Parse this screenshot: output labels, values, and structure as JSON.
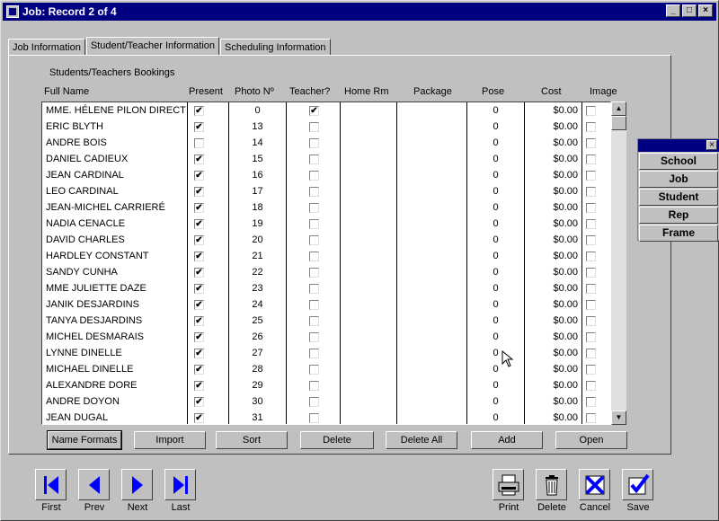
{
  "window": {
    "title": "Job: Record 2 of 4",
    "minimize": "_",
    "maximize": "□",
    "close": "×"
  },
  "tabs": [
    "Job Information",
    "Student/Teacher Information",
    "Scheduling Information"
  ],
  "section_title": "Students/Teachers Bookings",
  "columns": [
    "Full Name",
    "Present",
    "Photo Nº",
    "Teacher?",
    "Home Rm",
    "Package",
    "Pose",
    "Cost",
    "Image"
  ],
  "rows": [
    {
      "name": "MME. HÉLENE  PILON DIRECT",
      "present": true,
      "photo": "0",
      "teacher": true,
      "pose": "0",
      "cost": "$0.00",
      "image": false
    },
    {
      "name": "ERIC  BLYTH",
      "present": true,
      "photo": "13",
      "teacher": false,
      "pose": "0",
      "cost": "$0.00",
      "image": false
    },
    {
      "name": "ANDRE BOIS",
      "present": false,
      "photo": "14",
      "teacher": false,
      "pose": "0",
      "cost": "$0.00",
      "image": false
    },
    {
      "name": "DANIEL CADIEUX",
      "present": true,
      "photo": "15",
      "teacher": false,
      "pose": "0",
      "cost": "$0.00",
      "image": false
    },
    {
      "name": "JEAN CARDINAL",
      "present": true,
      "photo": "16",
      "teacher": false,
      "pose": "0",
      "cost": "$0.00",
      "image": false
    },
    {
      "name": "LEO CARDINAL",
      "present": true,
      "photo": "17",
      "teacher": false,
      "pose": "0",
      "cost": "$0.00",
      "image": false
    },
    {
      "name": "JEAN-MICHEL CARRIERÉ",
      "present": true,
      "photo": "18",
      "teacher": false,
      "pose": "0",
      "cost": "$0.00",
      "image": false
    },
    {
      "name": "NADIA CENACLE",
      "present": true,
      "photo": "19",
      "teacher": false,
      "pose": "0",
      "cost": "$0.00",
      "image": false
    },
    {
      "name": "DAVID CHARLES",
      "present": true,
      "photo": "20",
      "teacher": false,
      "pose": "0",
      "cost": "$0.00",
      "image": false
    },
    {
      "name": "HARDLEY CONSTANT",
      "present": true,
      "photo": "21",
      "teacher": false,
      "pose": "0",
      "cost": "$0.00",
      "image": false
    },
    {
      "name": "SANDY CUNHA",
      "present": true,
      "photo": "22",
      "teacher": false,
      "pose": "0",
      "cost": "$0.00",
      "image": false
    },
    {
      "name": "MME JULIETTE DAZE",
      "present": true,
      "photo": "23",
      "teacher": false,
      "pose": "0",
      "cost": "$0.00",
      "image": false
    },
    {
      "name": "JANIK DESJARDINS",
      "present": true,
      "photo": "24",
      "teacher": false,
      "pose": "0",
      "cost": "$0.00",
      "image": false
    },
    {
      "name": "TANYA DESJARDINS",
      "present": true,
      "photo": "25",
      "teacher": false,
      "pose": "0",
      "cost": "$0.00",
      "image": false
    },
    {
      "name": "MICHEL  DESMARAIS",
      "present": true,
      "photo": "26",
      "teacher": false,
      "pose": "0",
      "cost": "$0.00",
      "image": false
    },
    {
      "name": "LYNNE DINELLE",
      "present": true,
      "photo": "27",
      "teacher": false,
      "pose": "0",
      "cost": "$0.00",
      "image": false
    },
    {
      "name": "MICHAEL DINELLE",
      "present": true,
      "photo": "28",
      "teacher": false,
      "pose": "0",
      "cost": "$0.00",
      "image": false
    },
    {
      "name": "ALEXANDRE DORE",
      "present": true,
      "photo": "29",
      "teacher": false,
      "pose": "0",
      "cost": "$0.00",
      "image": false
    },
    {
      "name": "ANDRE DOYON",
      "present": true,
      "photo": "30",
      "teacher": false,
      "pose": "0",
      "cost": "$0.00",
      "image": false
    },
    {
      "name": "JEAN DUGAL",
      "present": true,
      "photo": "31",
      "teacher": false,
      "pose": "0",
      "cost": "$0.00",
      "image": false
    }
  ],
  "grid_buttons": [
    "Name Formats",
    "Import",
    "Sort",
    "Delete",
    "Delete All",
    "Add",
    "Open"
  ],
  "palette": [
    "School",
    "Job",
    "Student",
    "Rep",
    "Frame"
  ],
  "nav": [
    "First",
    "Prev",
    "Next",
    "Last"
  ],
  "actions": [
    "Print",
    "Delete",
    "Cancel",
    "Save"
  ],
  "check_glyph": "✔",
  "colors": {
    "title_bar": "#000080",
    "face": "#c0c0c0",
    "icon_blue": "#0000ff"
  }
}
